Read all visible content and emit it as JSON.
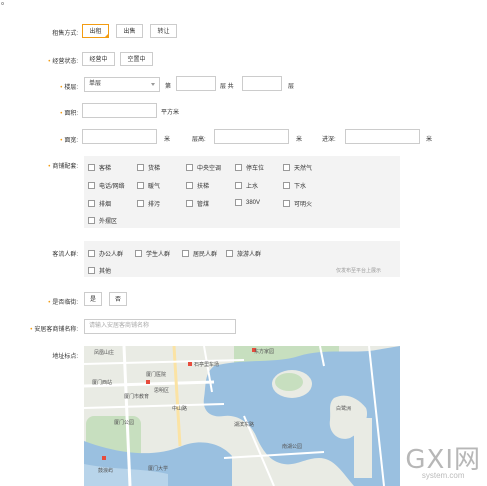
{
  "top_mark": "。",
  "rent_type": {
    "label": "租售方式:",
    "options": [
      "出租",
      "出售",
      "转让"
    ],
    "selected": "出租"
  },
  "business_status": {
    "label": "经营状态:",
    "options": [
      "经营中",
      "空置中"
    ]
  },
  "floor": {
    "label": "楼层:",
    "select_value": "单层",
    "text_di": "第",
    "text_ceng_gong": "层 共",
    "text_ceng": "层"
  },
  "area": {
    "label": "面积:",
    "unit": "平方米"
  },
  "dimensions": {
    "label": "面宽:",
    "unit1": "米",
    "height_label": "层高:",
    "unit2": "米",
    "depth_label": "进深:",
    "unit3": "米"
  },
  "facilities": {
    "label": "商铺配套:",
    "items": [
      "客梯",
      "货梯",
      "中央空调",
      "停车位",
      "天然气",
      "电话/网络",
      "暖气",
      "扶梯",
      "上水",
      "下水",
      "排烟",
      "排污",
      "管煤",
      "380V",
      "可明火",
      "外摆区"
    ]
  },
  "customers": {
    "label": "客流人群:",
    "items": [
      "办公人群",
      "学生人群",
      "居民人群",
      "旅游人群",
      "其他"
    ],
    "hint": "仅发布至平台上展示"
  },
  "street": {
    "label": "是否临街:",
    "options": [
      "是",
      "否"
    ]
  },
  "shop_name": {
    "label": "安居客商铺名称:",
    "placeholder": "请输入安居客商铺名称"
  },
  "location": {
    "label": "地址标点:"
  },
  "map_labels": [
    "东方家园",
    "石亭里车场",
    "厦门西站",
    "厦门医院",
    "凤凰山庄",
    "厦门市教育",
    "思明区",
    "厦门公园",
    "中山路",
    "鼓浪屿",
    "厦门大学",
    "湖滨东路",
    "南湖公园",
    "白鹭洲"
  ],
  "watermark": {
    "big": "GXI网",
    "small": "system.com"
  },
  "colors": {
    "accent": "#f39c12",
    "water": "#9ac0e0",
    "land": "#e9ebe4",
    "park": "#c7dfbf"
  }
}
